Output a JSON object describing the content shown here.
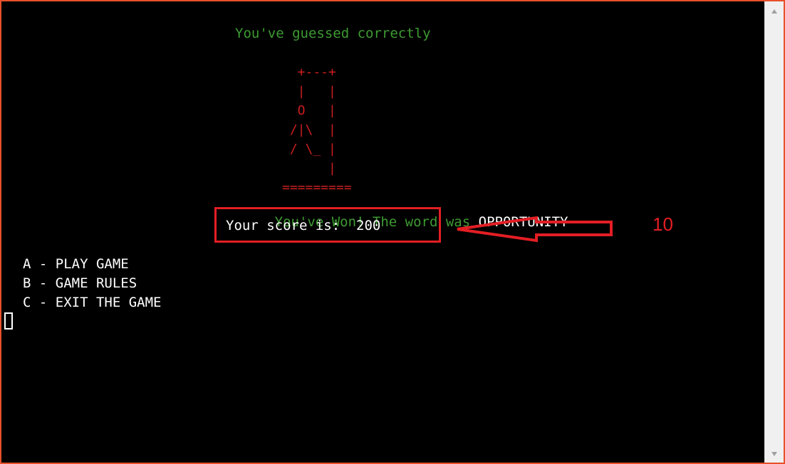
{
  "terminal": {
    "guess_message": "You've guessed correctly",
    "gallows_art": "  +---+\n  |   |\n  O   |\n /|\\  |\n / \\_ |\n      |\n=========",
    "won_message": "You've Won! The word was ",
    "secret_word": "OPPORTUNITY",
    "score_text": "Your score is:  200",
    "menu": [
      {
        "label": "A - PLAY GAME"
      },
      {
        "label": "B - GAME RULES"
      },
      {
        "label": "C - EXIT THE GAME"
      }
    ]
  },
  "annotation": {
    "number": "10",
    "color": "#e31e24"
  },
  "colors": {
    "frame_border": "#e8512a",
    "terminal_bg": "#000000",
    "message_green": "#3e9b32",
    "art_red": "#cc1f1f"
  }
}
